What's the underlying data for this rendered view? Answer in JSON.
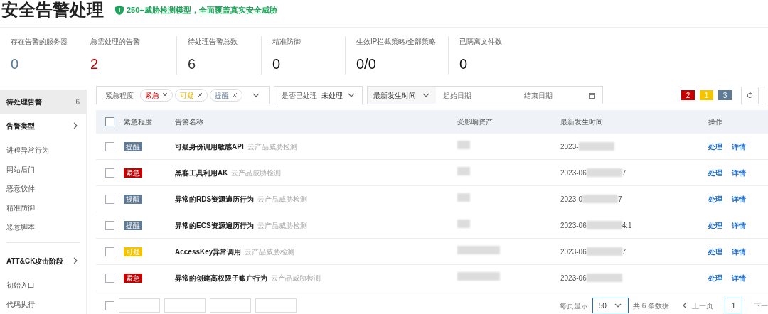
{
  "header": {
    "title": "安全告警处理",
    "badge": "250+威胁检测模型，全面覆盖真实安全威胁"
  },
  "stats": [
    {
      "label": "存在告警的服务器",
      "value": "0",
      "color": "#5b7c9d"
    },
    {
      "label": "急需处理的告警",
      "value": "2",
      "color": "#c40000"
    },
    {
      "label": "待处理告警总数",
      "value": "6",
      "color": "#333333"
    },
    {
      "label": "精准防御",
      "value": "0",
      "color": "#111111"
    },
    {
      "label": "生效IP拦截策略/全部策略",
      "value": "0/0",
      "color": "#111111"
    },
    {
      "label": "已隔离文件数",
      "value": "0",
      "color": "#111111"
    }
  ],
  "sidebar": {
    "items": [
      {
        "kind": "header",
        "label": "待处理告警",
        "count": "6",
        "selected": true
      },
      {
        "kind": "group",
        "label": "告警类型",
        "selected": false
      },
      {
        "kind": "item",
        "label": "进程异常行为",
        "selected": false
      },
      {
        "kind": "item",
        "label": "网站后门",
        "selected": false
      },
      {
        "kind": "item",
        "label": "恶意软件",
        "selected": false
      },
      {
        "kind": "item",
        "label": "精准防御",
        "selected": false
      },
      {
        "kind": "item",
        "label": "恶意脚本",
        "selected": false
      },
      {
        "kind": "divider"
      },
      {
        "kind": "group",
        "label": "ATT&CK攻击阶段",
        "selected": false
      },
      {
        "kind": "item",
        "label": "初始入口",
        "selected": false
      },
      {
        "kind": "item",
        "label": "代码执行",
        "selected": false
      }
    ]
  },
  "filters": {
    "severity": {
      "label": "紧急程度",
      "chips": [
        {
          "label": "紧急",
          "kind": "urgent"
        },
        {
          "label": "可疑",
          "kind": "suspicious"
        },
        {
          "label": "提醒",
          "kind": "notice"
        }
      ]
    },
    "handled": {
      "label": "是否已处理",
      "value": "未处理"
    },
    "time": {
      "label": "最新发生时间",
      "start_placeholder": "起始日期",
      "end_placeholder": "结束日期"
    },
    "counts": [
      {
        "value": "2",
        "kind": "urgent"
      },
      {
        "value": "1",
        "kind": "suspicious"
      },
      {
        "value": "3",
        "kind": "notice"
      }
    ]
  },
  "table": {
    "select_all_checked": false,
    "columns": [
      "紧急程度",
      "告警名称",
      "受影响资产",
      "最新发生时间",
      "操作"
    ],
    "rows": [
      {
        "checked": false,
        "severity": {
          "label": "提醒",
          "kind": "notice"
        },
        "name": "可疑身份调用敏感API",
        "source": "云产品威胁检测",
        "asset_wide": false,
        "time": "2023-",
        "actions": [
          "处理",
          "详情"
        ]
      },
      {
        "checked": false,
        "severity": {
          "label": "紧急",
          "kind": "urgent"
        },
        "name": "黑客工具利用AK",
        "source": "云产品威胁检测",
        "asset_wide": false,
        "time": "2023-06",
        "time_end": "7",
        "actions": [
          "处理",
          "详情"
        ]
      },
      {
        "checked": false,
        "severity": {
          "label": "提醒",
          "kind": "notice"
        },
        "name": "异常的RDS资源遍历行为",
        "source": "云产品威胁检测",
        "asset_wide": false,
        "time": "2023-0",
        "time_end": "7",
        "actions": [
          "处理",
          "详情"
        ]
      },
      {
        "checked": false,
        "severity": {
          "label": "提醒",
          "kind": "notice"
        },
        "name": "异常的ECS资源遍历行为",
        "source": "云产品威胁检测",
        "asset_wide": false,
        "time": "2023-06",
        "time_end": "4:1",
        "actions": [
          "处理",
          "详情"
        ]
      },
      {
        "checked": false,
        "severity": {
          "label": "可疑",
          "kind": "suspicious"
        },
        "name": "AccessKey异常调用",
        "source": "云产品威胁检测",
        "asset_wide": true,
        "time": "2023-06",
        "time_end": "7",
        "actions": [
          "处理",
          "详情"
        ]
      },
      {
        "checked": false,
        "severity": {
          "label": "紧急",
          "kind": "urgent"
        },
        "name": "异常的创建高权限子账户行为",
        "source": "云产品威胁检测",
        "asset_wide": true,
        "time": "2023-06",
        "actions": [
          "处理",
          "详情"
        ]
      }
    ]
  },
  "footer": {
    "select_all_checked": false,
    "page_size_label": "每页显示",
    "page_size": "50",
    "total": "共 6 条数据",
    "prev": "上一页",
    "page": "1",
    "next": "下一"
  }
}
